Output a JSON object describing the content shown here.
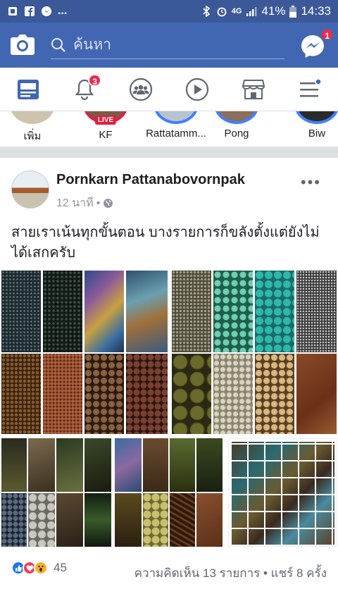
{
  "status_bar": {
    "dots": "...",
    "network": "4G",
    "battery": "41%",
    "time": "14:33"
  },
  "search": {
    "placeholder": "ค้นหา"
  },
  "badges": {
    "messenger": "1",
    "notifications": "3"
  },
  "stories": [
    {
      "label": "เพิ่ม",
      "live": false
    },
    {
      "label": "KF",
      "live": true,
      "live_label": "LIVE"
    },
    {
      "label": "Rattatamm...",
      "live": false
    },
    {
      "label": "Pong",
      "live": false
    },
    {
      "label": "Biw",
      "live": false
    }
  ],
  "post": {
    "author": "Pornkarn Pattanabovornpak",
    "time": "12 นาที",
    "text": "สายเราเน้นทุกขั้นตอน บางรายการก็ขลังตั้งแต่ยังไม่ได้เสกครับ",
    "reaction_count": "45",
    "stats": "ความคิดเห็น 13 รายการ • แชร์ 8 ครั้ง"
  },
  "colors": {
    "brand": "#4267b2",
    "status": "#3b5998",
    "badge": "#f02849"
  }
}
